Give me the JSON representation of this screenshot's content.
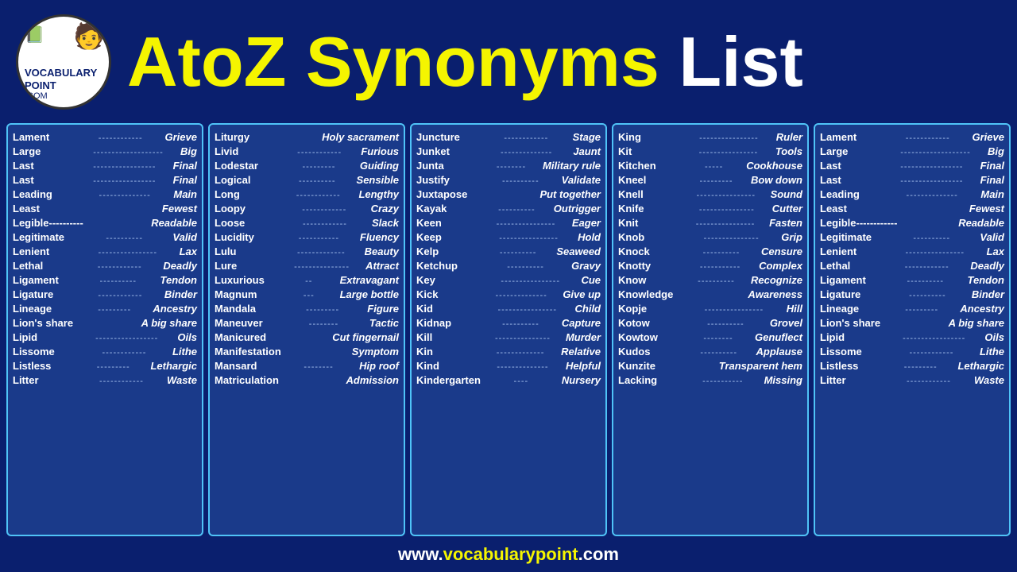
{
  "header": {
    "logo": {
      "vocab": "VOCABULARY",
      "point": "POINT",
      "com": ".COM"
    },
    "title": {
      "part1": "AtoZ",
      "part2": " Synonyms ",
      "part3": "List"
    }
  },
  "columns": [
    {
      "id": "col1",
      "words": [
        {
          "word": "Lament",
          "dots": "------------",
          "synonym": "Grieve"
        },
        {
          "word": "Large",
          "dots": "-------------------",
          "synonym": "Big"
        },
        {
          "word": "Last",
          "dots": "-----------------",
          "synonym": "Final"
        },
        {
          "word": "Last",
          "dots": "-----------------",
          "synonym": "Final"
        },
        {
          "word": "Leading",
          "dots": "--------------",
          "synonym": "Main"
        },
        {
          "word": "Least",
          "dots": "",
          "synonym": "Fewest"
        },
        {
          "word": "Legible----------",
          "dots": "",
          "synonym": "Readable"
        },
        {
          "word": "Legitimate",
          "dots": "----------",
          "synonym": "Valid"
        },
        {
          "word": "Lenient",
          "dots": "----------------",
          "synonym": "Lax"
        },
        {
          "word": "Lethal",
          "dots": "------------",
          "synonym": "Deadly"
        },
        {
          "word": "Ligament",
          "dots": "----------",
          "synonym": "Tendon"
        },
        {
          "word": "Ligature",
          "dots": "------------",
          "synonym": "Binder"
        },
        {
          "word": "Lineage",
          "dots": "---------",
          "synonym": "Ancestry"
        },
        {
          "word": "Lion's share",
          "dots": "",
          "synonym": "A big share"
        },
        {
          "word": "Lipid",
          "dots": "-----------------",
          "synonym": "Oils"
        },
        {
          "word": "Lissome",
          "dots": "------------",
          "synonym": "Lithe"
        },
        {
          "word": "Listless",
          "dots": "---------",
          "synonym": "Lethargic"
        },
        {
          "word": "Litter",
          "dots": "------------",
          "synonym": "Waste"
        }
      ]
    },
    {
      "id": "col2",
      "words": [
        {
          "word": "Liturgy",
          "dots": "",
          "synonym": "Holy sacrament"
        },
        {
          "word": "Livid",
          "dots": "------------",
          "synonym": "Furious"
        },
        {
          "word": "Lodestar",
          "dots": "---------",
          "synonym": "Guiding"
        },
        {
          "word": "Logical",
          "dots": "----------",
          "synonym": "Sensible"
        },
        {
          "word": "Long",
          "dots": "------------",
          "synonym": "Lengthy"
        },
        {
          "word": "Loopy",
          "dots": "------------",
          "synonym": "Crazy"
        },
        {
          "word": "Loose",
          "dots": "------------",
          "synonym": "Slack"
        },
        {
          "word": "Lucidity",
          "dots": "-----------",
          "synonym": "Fluency"
        },
        {
          "word": "Lulu",
          "dots": "-------------",
          "synonym": "Beauty"
        },
        {
          "word": "Lure",
          "dots": "---------------",
          "synonym": "Attract"
        },
        {
          "word": "Luxurious",
          "dots": "--",
          "synonym": "Extravagant"
        },
        {
          "word": "Magnum",
          "dots": "---",
          "synonym": "Large bottle"
        },
        {
          "word": "Mandala",
          "dots": "---------",
          "synonym": "Figure"
        },
        {
          "word": "Maneuver",
          "dots": "--------",
          "synonym": "Tactic"
        },
        {
          "word": "Manicured",
          "dots": "",
          "synonym": "Cut fingernail"
        },
        {
          "word": "Manifestation",
          "dots": "",
          "synonym": "Symptom"
        },
        {
          "word": "Mansard",
          "dots": "--------",
          "synonym": "Hip roof"
        },
        {
          "word": "Matriculation",
          "dots": "",
          "synonym": "Admission"
        }
      ]
    },
    {
      "id": "col3",
      "words": [
        {
          "word": "Juncture",
          "dots": "------------",
          "synonym": "Stage"
        },
        {
          "word": "Junket",
          "dots": "--------------",
          "synonym": "Jaunt"
        },
        {
          "word": "Junta",
          "dots": "--------",
          "synonym": "Military rule"
        },
        {
          "word": "Justify",
          "dots": "----------",
          "synonym": "Validate"
        },
        {
          "word": "Juxtapose",
          "dots": "",
          "synonym": "Put together"
        },
        {
          "word": "Kayak",
          "dots": "----------",
          "synonym": "Outrigger"
        },
        {
          "word": "Keen",
          "dots": "----------------",
          "synonym": "Eager"
        },
        {
          "word": "Keep",
          "dots": "----------------",
          "synonym": "Hold"
        },
        {
          "word": "Kelp",
          "dots": "----------",
          "synonym": "Seaweed"
        },
        {
          "word": "Ketchup",
          "dots": "----------",
          "synonym": "Gravy"
        },
        {
          "word": "Key",
          "dots": "----------------",
          "synonym": "Cue"
        },
        {
          "word": "Kick",
          "dots": "--------------",
          "synonym": "Give up"
        },
        {
          "word": "Kid",
          "dots": "----------------",
          "synonym": "Child"
        },
        {
          "word": "Kidnap",
          "dots": "----------",
          "synonym": "Capture"
        },
        {
          "word": "Kill",
          "dots": "---------------",
          "synonym": "Murder"
        },
        {
          "word": "Kin",
          "dots": "-------------",
          "synonym": "Relative"
        },
        {
          "word": "Kind",
          "dots": "--------------",
          "synonym": "Helpful"
        },
        {
          "word": "Kindergarten",
          "dots": "----",
          "synonym": "Nursery"
        }
      ]
    },
    {
      "id": "col4",
      "words": [
        {
          "word": "King",
          "dots": "----------------",
          "synonym": "Ruler"
        },
        {
          "word": "Kit",
          "dots": "----------------",
          "synonym": "Tools"
        },
        {
          "word": "Kitchen",
          "dots": "-----",
          "synonym": "Cookhouse"
        },
        {
          "word": "Kneel",
          "dots": "---------",
          "synonym": "Bow down"
        },
        {
          "word": "Knell",
          "dots": "----------------",
          "synonym": "Sound"
        },
        {
          "word": "Knife",
          "dots": "---------------",
          "synonym": "Cutter"
        },
        {
          "word": "Knit",
          "dots": "----------------",
          "synonym": "Fasten"
        },
        {
          "word": "Knob",
          "dots": "---------------",
          "synonym": "Grip"
        },
        {
          "word": "Knock",
          "dots": "----------",
          "synonym": "Censure"
        },
        {
          "word": "Knotty",
          "dots": "-----------",
          "synonym": "Complex"
        },
        {
          "word": "Know",
          "dots": "----------",
          "synonym": "Recognize"
        },
        {
          "word": "Knowledge",
          "dots": "",
          "synonym": "Awareness"
        },
        {
          "word": "Kopje",
          "dots": "----------------",
          "synonym": "Hill"
        },
        {
          "word": "Kotow",
          "dots": "----------",
          "synonym": "Grovel"
        },
        {
          "word": "Kowtow",
          "dots": "--------",
          "synonym": "Genuflect"
        },
        {
          "word": "Kudos",
          "dots": "----------",
          "synonym": "Applause"
        },
        {
          "word": "Kunzite",
          "dots": "",
          "synonym": "Transparent hem"
        },
        {
          "word": "Lacking",
          "dots": "-----------",
          "synonym": "Missing"
        }
      ]
    },
    {
      "id": "col5",
      "words": [
        {
          "word": "Lament",
          "dots": "------------",
          "synonym": "Grieve"
        },
        {
          "word": "Large",
          "dots": "-------------------",
          "synonym": "Big"
        },
        {
          "word": "Last",
          "dots": "-----------------",
          "synonym": "Final"
        },
        {
          "word": "Last",
          "dots": "-----------------",
          "synonym": "Final"
        },
        {
          "word": "Leading",
          "dots": "--------------",
          "synonym": "Main"
        },
        {
          "word": "Least",
          "dots": "",
          "synonym": "Fewest"
        },
        {
          "word": "Legible------------",
          "dots": "",
          "synonym": "Readable"
        },
        {
          "word": "Legitimate",
          "dots": "----------",
          "synonym": "Valid"
        },
        {
          "word": "Lenient",
          "dots": "----------------",
          "synonym": "Lax"
        },
        {
          "word": "Lethal",
          "dots": "------------",
          "synonym": "Deadly"
        },
        {
          "word": "Ligament",
          "dots": "----------",
          "synonym": "Tendon"
        },
        {
          "word": "Ligature",
          "dots": "----------",
          "synonym": "Binder"
        },
        {
          "word": "Lineage",
          "dots": "---------",
          "synonym": "Ancestry"
        },
        {
          "word": "Lion's share",
          "dots": "",
          "synonym": "A big share"
        },
        {
          "word": "Lipid",
          "dots": "-----------------",
          "synonym": "Oils"
        },
        {
          "word": "Lissome",
          "dots": "------------",
          "synonym": "Lithe"
        },
        {
          "word": "Listless",
          "dots": "---------",
          "synonym": "Lethargic"
        },
        {
          "word": "Litter",
          "dots": "------------",
          "synonym": "Waste"
        }
      ]
    }
  ],
  "footer": {
    "prefix": "www.",
    "highlight": "vocabularypoint",
    "suffix": ".com"
  }
}
